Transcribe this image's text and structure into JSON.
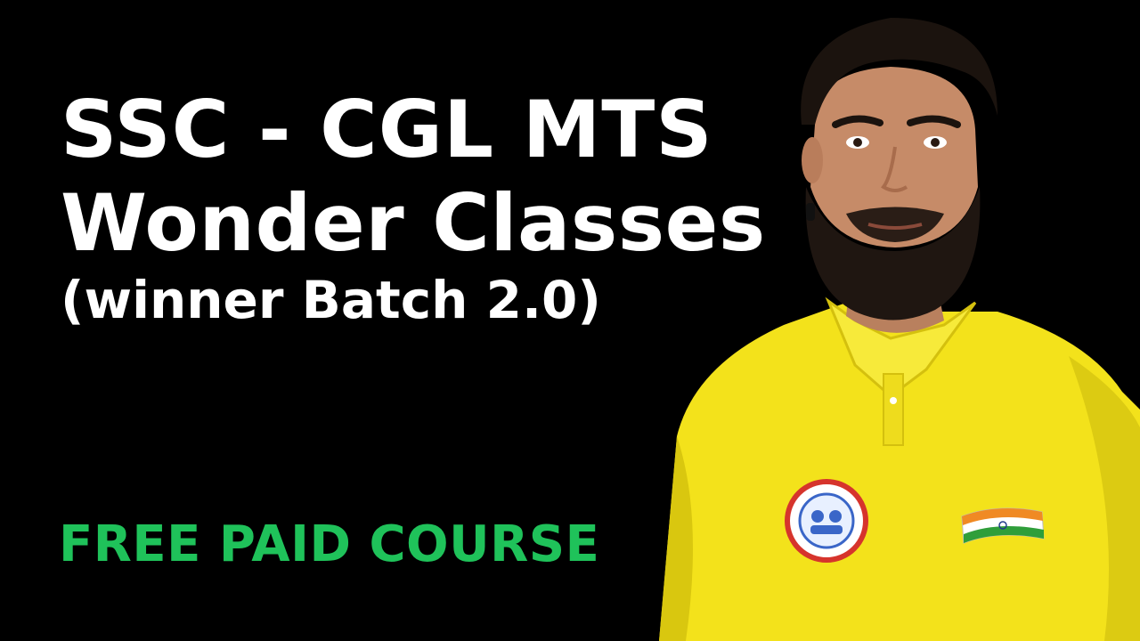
{
  "thumbnail": {
    "title_line1": "SSC - CGL MTS",
    "title_line2": "Wonder Classes",
    "title_line3": "(winner Batch 2.0)",
    "tagline": "FREE PAID COURSE"
  },
  "colors": {
    "background": "#000000",
    "title_text": "#ffffff",
    "tagline_text": "#1fc25a",
    "shirt": "#f3e21b"
  },
  "presenter": {
    "icon": "presenter-photo",
    "badges": [
      "circular-logo-badge",
      "flag-badge"
    ]
  }
}
